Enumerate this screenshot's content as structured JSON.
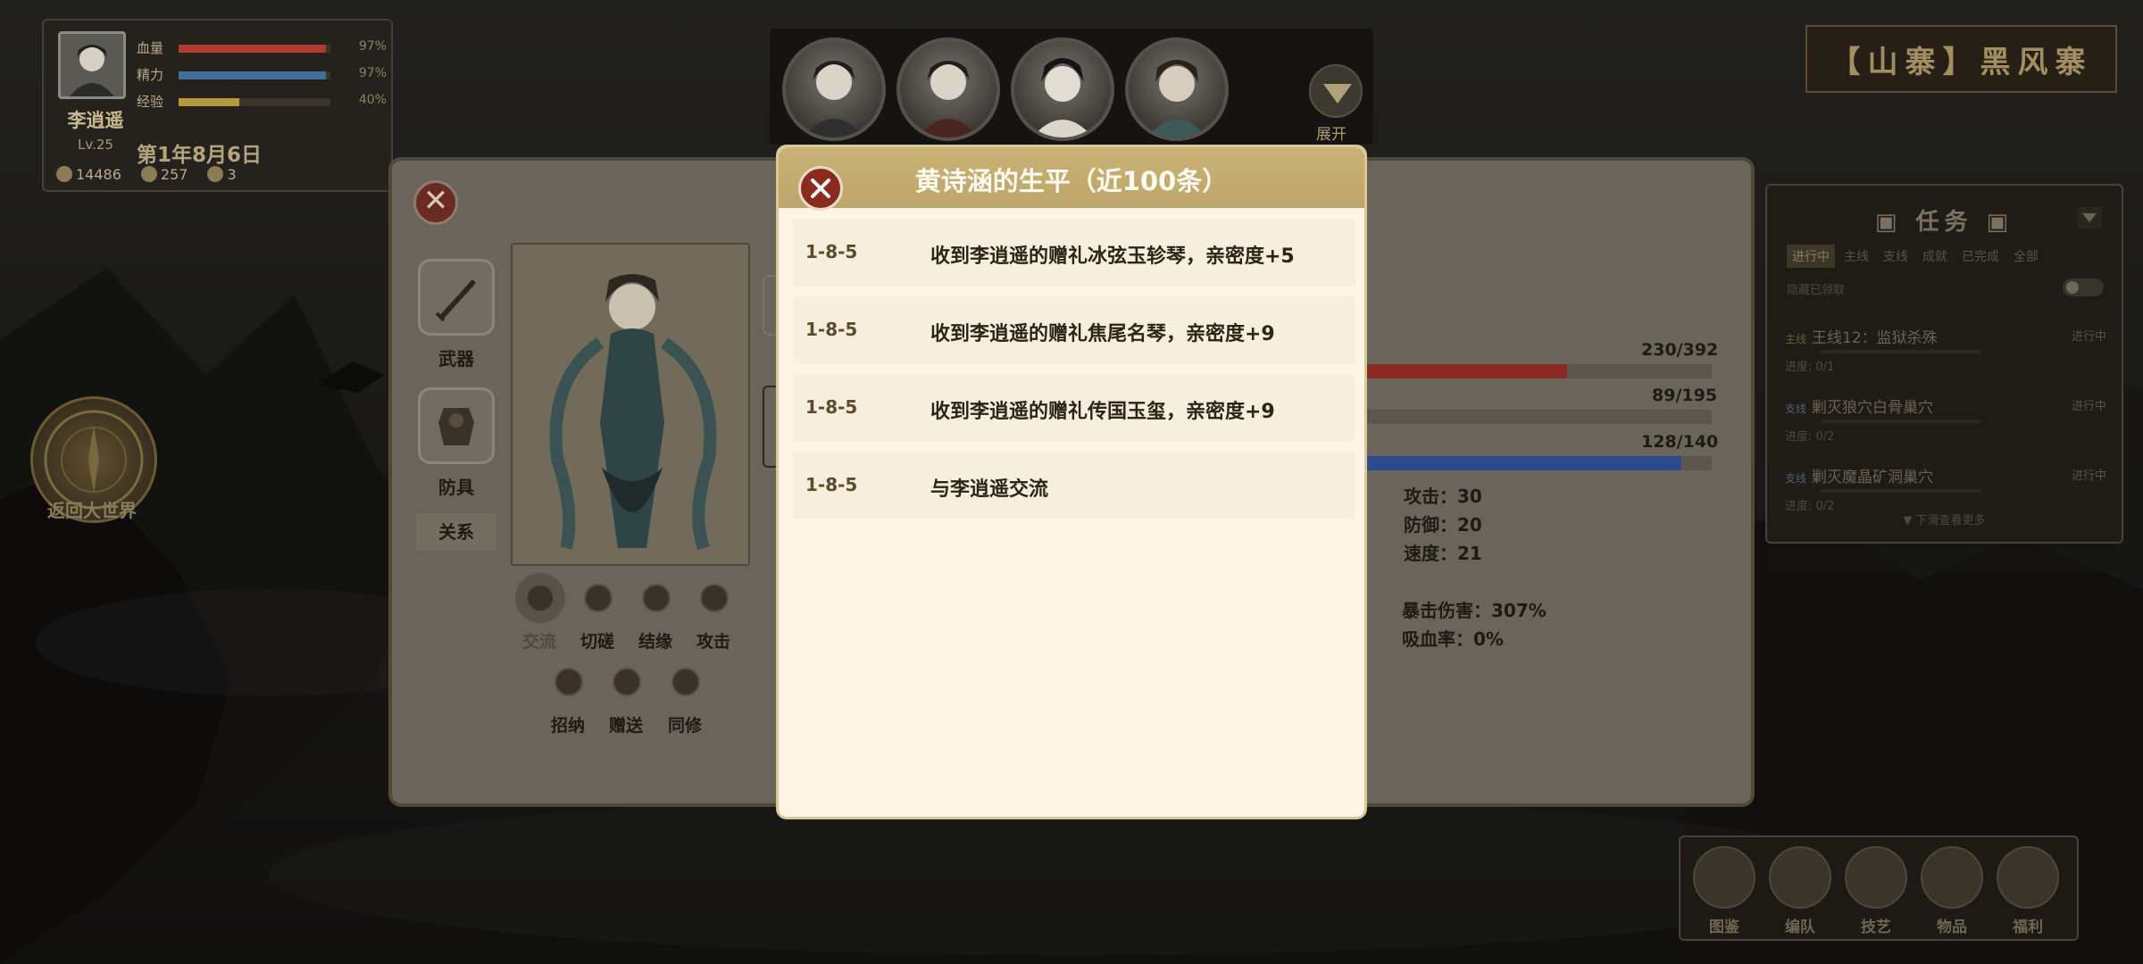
{
  "player": {
    "name": "李逍遥",
    "level": "Lv.25",
    "bars": [
      {
        "label": "血量",
        "pct_text": "97%",
        "fill": 0.97,
        "color": "#b23a2c"
      },
      {
        "label": "精力",
        "pct_text": "97%",
        "fill": 0.97,
        "color": "#3f6f9e"
      },
      {
        "label": "经验",
        "pct_text": "40%",
        "fill": 0.4,
        "color": "#b39a3a"
      }
    ],
    "date": "第1年8月6日",
    "resources": [
      {
        "icon": "coin-icon",
        "value": "14486"
      },
      {
        "icon": "hat-icon",
        "value": "257"
      },
      {
        "icon": "crown-icon",
        "value": "3"
      }
    ]
  },
  "portraits": {
    "count": 4,
    "expand_label": "展开"
  },
  "location": {
    "label": "【山寨】黑风寨"
  },
  "return_world": {
    "label": "返回大世界"
  },
  "character_panel": {
    "equipment": [
      {
        "label": "武器",
        "icon": "sword-icon"
      },
      {
        "label": "防具",
        "icon": "armor-icon"
      }
    ],
    "relation_label": "关系",
    "actions_row1": [
      {
        "label": "交流",
        "icon": "chat-icon",
        "active": true
      },
      {
        "label": "切磋",
        "icon": "crossed-swords-icon"
      },
      {
        "label": "结缘",
        "icon": "bond-icon"
      },
      {
        "label": "攻击",
        "icon": "attack-icon"
      }
    ],
    "actions_row2": [
      {
        "label": "招纳",
        "icon": "recruit-icon"
      },
      {
        "label": "赠送",
        "icon": "gift-icon"
      },
      {
        "label": "同修",
        "icon": "cultivate-icon"
      }
    ],
    "stat_bars": [
      {
        "text": "230/392",
        "fill": 0.587,
        "color": "#8a2a22"
      },
      {
        "text": "89/195",
        "fill": 0.456,
        "color": "#5c574e"
      },
      {
        "text": "128/140",
        "fill": 0.914,
        "color": "#2c4a8e"
      }
    ],
    "attributes": [
      {
        "label": "攻击：",
        "value": "30"
      },
      {
        "label": "防御：",
        "value": "20"
      },
      {
        "label": "速度：",
        "value": "21"
      }
    ],
    "attributes2": [
      {
        "label": "暴击伤害：",
        "value": "307%"
      },
      {
        "label": "吸血率：",
        "value": "0%"
      }
    ]
  },
  "tasks": {
    "title": "任务",
    "tabs": [
      "进行中",
      "主线",
      "支线",
      "成就",
      "已完成",
      "全部"
    ],
    "active_tab": 0,
    "filter_label": "隐藏已领取",
    "items": [
      {
        "tag": "主线",
        "name": "王线12：监狱杀殊",
        "state": "进行中",
        "progress": "进度: 0/1"
      },
      {
        "tag": "支线",
        "name": "剿灭狼穴白骨巢穴",
        "state": "进行中",
        "progress": "进度: 0/2"
      },
      {
        "tag": "支线",
        "name": "剿灭魔晶矿洞巢穴",
        "state": "进行中",
        "progress": "进度: 0/2"
      }
    ],
    "more_label": "▼ 下滑查看更多"
  },
  "menu": [
    {
      "label": "图鉴",
      "icon": "codex-icon"
    },
    {
      "label": "编队",
      "icon": "team-icon"
    },
    {
      "label": "技艺",
      "icon": "skill-icon"
    },
    {
      "label": "物品",
      "icon": "bag-icon"
    },
    {
      "label": "福利",
      "icon": "mail-icon"
    }
  ],
  "modal": {
    "title": "黄诗涵的生平（近100条）",
    "events": [
      {
        "date": "1-8-5",
        "text": "收到李逍遥的赠礼冰弦玉轸琴，亲密度+5"
      },
      {
        "date": "1-8-5",
        "text": "收到李逍遥的赠礼焦尾名琴，亲密度+9"
      },
      {
        "date": "1-8-5",
        "text": "收到李逍遥的赠礼传国玉玺，亲密度+9"
      },
      {
        "date": "1-8-5",
        "text": "与李逍遥交流"
      }
    ]
  }
}
